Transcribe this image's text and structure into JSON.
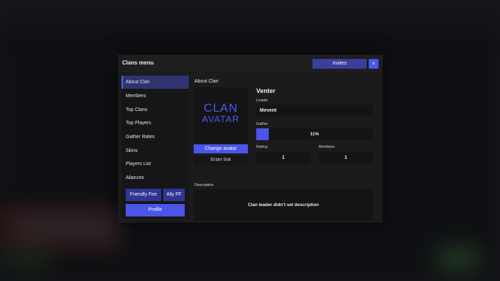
{
  "header": {
    "title": "Clans menu",
    "invites_label": "Invites",
    "close_glyph": "×"
  },
  "sidebar": {
    "items": [
      {
        "label": "About Clan",
        "active": true
      },
      {
        "label": "Members"
      },
      {
        "label": "Top Clans"
      },
      {
        "label": "Top Players"
      },
      {
        "label": "Gather Rates"
      },
      {
        "label": "Skins"
      },
      {
        "label": "Players List"
      },
      {
        "label": "Aliances"
      }
    ],
    "friendly_fire_label": "Friendly Fire",
    "ally_ff_label": "Ally FF",
    "profile_label": "Profile"
  },
  "about": {
    "section_title": "About Clan",
    "avatar_line1": "CLAN",
    "avatar_line2": "AVATAR",
    "change_avatar_label": "Change avatar",
    "enter_link_label": "Enter link",
    "clan_name": "Venter",
    "leader_label": "Leader",
    "leader_value": "Mevent",
    "gather_label": "Gather",
    "gather_text": "11%",
    "gather_fraction": 0.11,
    "rating_label": "Rating",
    "rating_value": "1",
    "members_label": "Members",
    "members_value": "1",
    "description_label": "Description",
    "description_text": "Clan leader didn't set description"
  },
  "colors": {
    "accent": "#4b56e8",
    "accent_dark": "#2f3592",
    "panel": "#1b1b1e",
    "field": "#141416"
  },
  "icons": {
    "close": "close-icon"
  }
}
